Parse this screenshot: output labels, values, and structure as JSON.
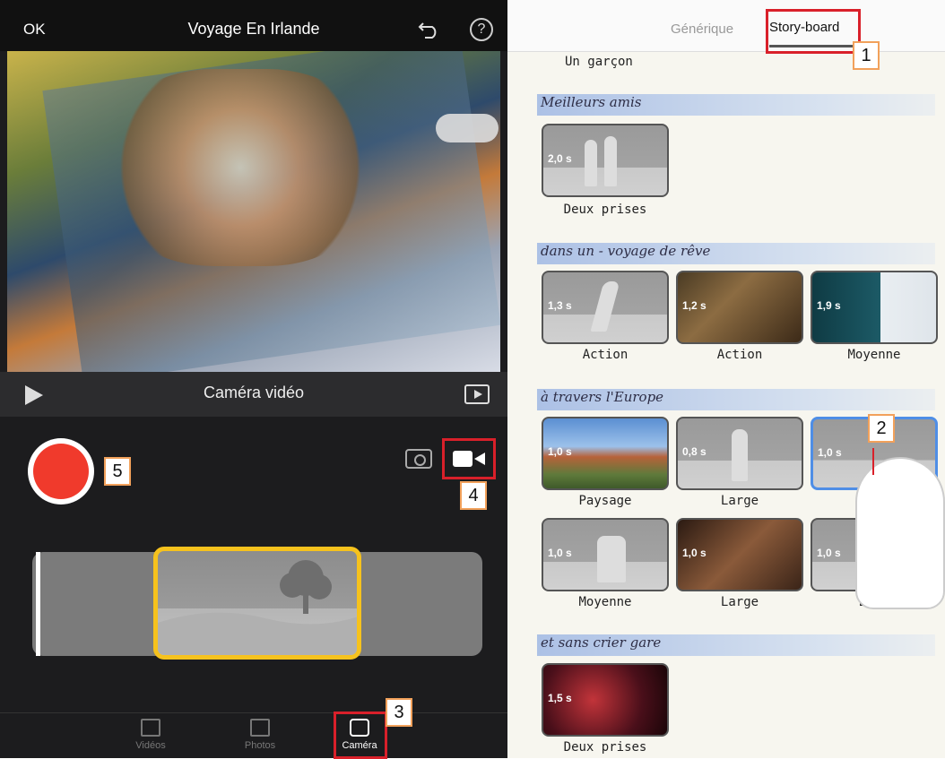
{
  "left": {
    "topbar": {
      "ok": "OK",
      "title": "Voyage En Irlande",
      "help": "?"
    },
    "playbar": {
      "label": "Caméra vidéo"
    },
    "tabs": [
      {
        "label": "Vidéos"
      },
      {
        "label": "Photos"
      },
      {
        "label": "Caméra"
      }
    ]
  },
  "right": {
    "tabs": {
      "generique": "Générique",
      "storyboard": "Story-board"
    },
    "top_caption": "Un garçon",
    "sections": [
      {
        "title": "Meilleurs amis",
        "shots": [
          {
            "dur": "2,0 s",
            "caption": "Deux prises"
          }
        ]
      },
      {
        "title": "dans un - voyage de rêve",
        "shots": [
          {
            "dur": "1,3 s",
            "caption": "Action"
          },
          {
            "dur": "1,2 s",
            "caption": "Action"
          },
          {
            "dur": "1,9 s",
            "caption": "Moyenne"
          }
        ]
      },
      {
        "title": "à travers l'Europe",
        "shots": [
          {
            "dur": "1,0 s",
            "caption": "Paysage"
          },
          {
            "dur": "0,8 s",
            "caption": "Large"
          },
          {
            "dur": "1,0 s",
            "caption": "Pa"
          },
          {
            "dur": "1,0 s",
            "caption": "Moyenne"
          },
          {
            "dur": "1,0 s",
            "caption": "Large"
          },
          {
            "dur": "1,0 s",
            "caption": "Deux"
          }
        ]
      },
      {
        "title": "et sans crier gare",
        "shots": [
          {
            "dur": "1,5 s",
            "caption": "Deux prises"
          }
        ]
      }
    ]
  },
  "callouts": [
    "1",
    "2",
    "3",
    "4",
    "5"
  ],
  "colors": {
    "accent_red": "#d9202a",
    "callout_border": "#f2a15b",
    "clip_border": "#f6c21d",
    "record": "#f03a2c"
  }
}
